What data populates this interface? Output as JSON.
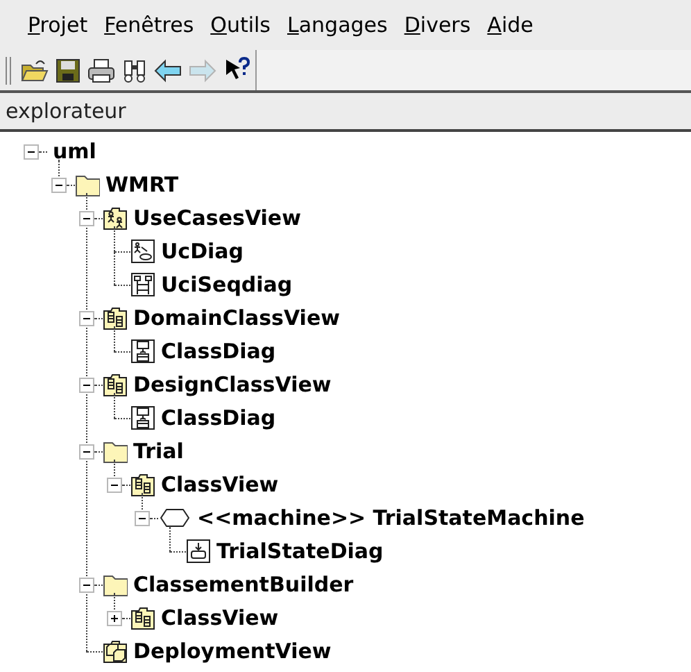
{
  "menu": [
    "Projet",
    "Fenêtres",
    "Outils",
    "Langages",
    "Divers",
    "Aide"
  ],
  "toolbar": [
    {
      "kind": "open",
      "disabled": false
    },
    {
      "kind": "save",
      "disabled": false
    },
    {
      "kind": "print",
      "disabled": false
    },
    {
      "kind": "find",
      "disabled": false
    },
    {
      "kind": "back",
      "disabled": false
    },
    {
      "kind": "forward",
      "disabled": true
    },
    {
      "kind": "help",
      "disabled": false
    }
  ],
  "panel": {
    "title": "explorateur"
  },
  "tree": [
    {
      "label": "uml",
      "expanded": true,
      "children": [
        {
          "label": "WMRT",
          "kind": "folder",
          "expanded": true,
          "children": [
            {
              "label": "UseCasesView",
              "kind": "usecaseview",
              "expanded": true,
              "children": [
                {
                  "label": "UcDiag",
                  "kind": "usecasediagram"
                },
                {
                  "label": "UciSeqdiag",
                  "kind": "sequencediagram"
                }
              ]
            },
            {
              "label": "DomainClassView",
              "kind": "classview",
              "expanded": true,
              "children": [
                {
                  "label": "ClassDiag",
                  "kind": "classdiagram"
                }
              ]
            },
            {
              "label": "DesignClassView",
              "kind": "classview",
              "expanded": true,
              "children": [
                {
                  "label": "ClassDiag",
                  "kind": "classdiagram"
                }
              ]
            },
            {
              "label": "Trial",
              "kind": "folder",
              "expanded": true,
              "children": [
                {
                  "label": "ClassView",
                  "kind": "classview",
                  "expanded": true,
                  "children": [
                    {
                      "label": "<<machine>> TrialStateMachine",
                      "kind": "statemachine",
                      "expanded": true,
                      "children": [
                        {
                          "label": "TrialStateDiag",
                          "kind": "statediagram"
                        }
                      ]
                    }
                  ]
                }
              ]
            },
            {
              "label": "ClassementBuilder",
              "kind": "folder",
              "expanded": true,
              "children": [
                {
                  "label": "ClassView",
                  "kind": "classview",
                  "expanded": false
                }
              ]
            },
            {
              "label": "DeploymentView",
              "kind": "deploymentview"
            }
          ]
        }
      ]
    }
  ]
}
